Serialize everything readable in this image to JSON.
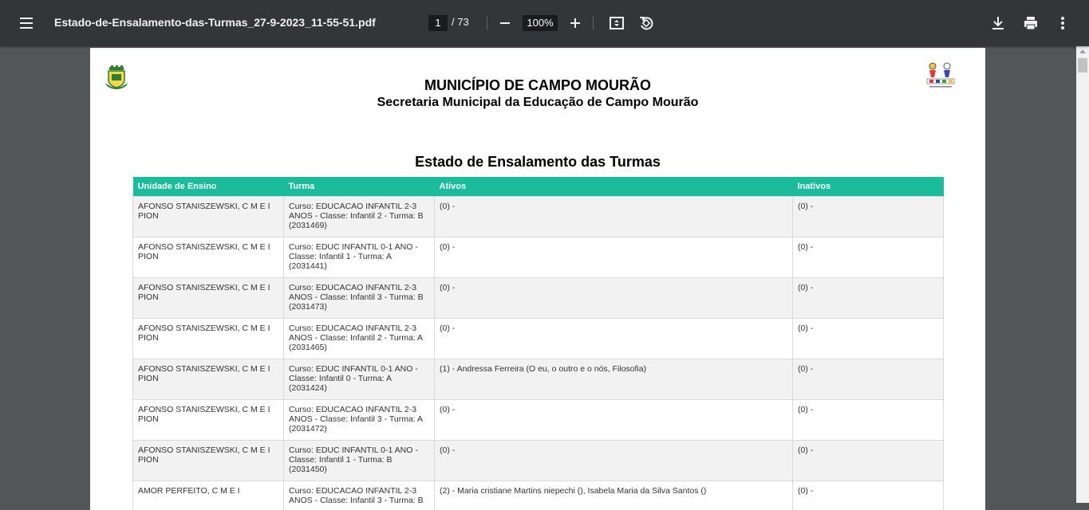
{
  "toolbar": {
    "menu_icon": "menu-icon",
    "file_title": "Estado-de-Ensalamento-das-Turmas_27-9-2023_11-55-51.pdf",
    "current_page": "1",
    "page_total": "/ 73",
    "zoom": "100%",
    "icons": [
      "zoom-out-icon",
      "zoom-in-icon",
      "fit-page-icon",
      "rotate-icon",
      "download-icon",
      "print-icon",
      "more-options-icon"
    ]
  },
  "document": {
    "heading": "MUNICÍPIO DE CAMPO MOURÃO",
    "subheading": "Secretaria Municipal da Educação de Campo Mourão",
    "report_title": "Estado de Ensalamento das Turmas",
    "columns": [
      "Unidade de Ensino",
      "Turma",
      "Ativos",
      "Inativos"
    ],
    "rows": [
      {
        "unidade": "AFONSO STANISZEWSKI, C M E I PION",
        "turma": "Curso: EDUCACAO INFANTIL 2-3 ANOS - Classe: Infantil 2 - Turma: B (2031469)",
        "ativos": "(0) -",
        "inativos": "(0) -"
      },
      {
        "unidade": "AFONSO STANISZEWSKI, C M E I PION",
        "turma": "Curso: EDUC INFANTIL 0-1 ANO - Classe: Infantil 1 - Turma: A (2031441)",
        "ativos": "(0) -",
        "inativos": "(0) -"
      },
      {
        "unidade": "AFONSO STANISZEWSKI, C M E I PION",
        "turma": "Curso: EDUCACAO INFANTIL 2-3 ANOS - Classe: Infantil 3 - Turma: B (2031473)",
        "ativos": "(0) -",
        "inativos": "(0) -"
      },
      {
        "unidade": "AFONSO STANISZEWSKI, C M E I PION",
        "turma": "Curso: EDUCACAO INFANTIL 2-3 ANOS - Classe: Infantil 2 - Turma: A (2031465)",
        "ativos": "(0) -",
        "inativos": "(0) -"
      },
      {
        "unidade": "AFONSO STANISZEWSKI, C M E I PION",
        "turma": "Curso: EDUC INFANTIL 0-1 ANO - Classe: Infantil 0 - Turma: A (2031424)",
        "ativos": "(1) - Andressa Ferreira  (O eu, o outro e o nós, Filosofia)",
        "inativos": "(0) -"
      },
      {
        "unidade": "AFONSO STANISZEWSKI, C M E I PION",
        "turma": "Curso: EDUCACAO INFANTIL 2-3 ANOS - Classe: Infantil 3 - Turma: A (2031472)",
        "ativos": "(0) -",
        "inativos": "(0) -"
      },
      {
        "unidade": "AFONSO STANISZEWSKI, C M E I PION",
        "turma": "Curso: EDUC INFANTIL 0-1 ANO - Classe: Infantil 1 - Turma: B (2031450)",
        "ativos": "(0) -",
        "inativos": "(0) -"
      },
      {
        "unidade": "AMOR PERFEITO, C M E I",
        "turma": "Curso: EDUCACAO INFANTIL 2-3 ANOS - Classe: Infantil 3 - Turma: B",
        "ativos": "(2) - Maria cristiane Martins niepechi (), Isabela Maria da Silva Santos ()",
        "inativos": "(0) -"
      }
    ]
  },
  "colors": {
    "toolbar_bg": "#323639",
    "viewer_bg": "#525659",
    "table_header": "#1abc9c"
  }
}
